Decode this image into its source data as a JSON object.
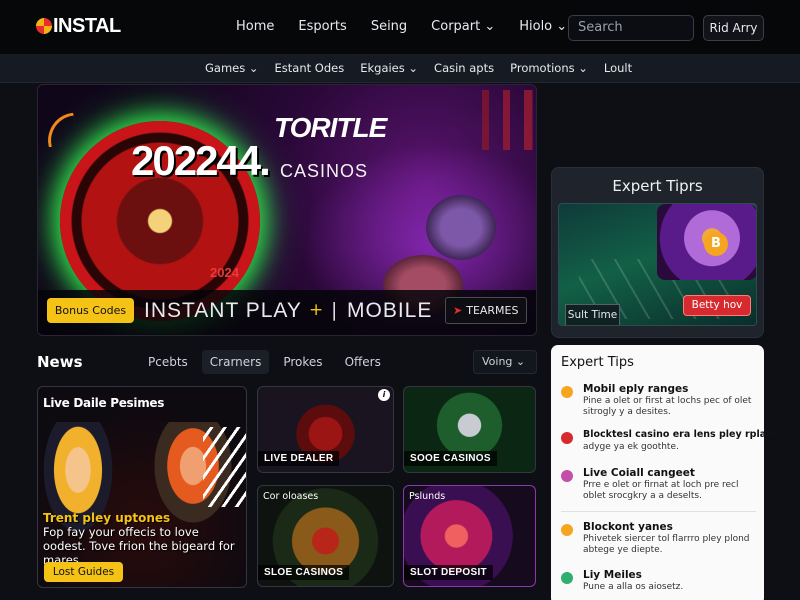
{
  "header": {
    "logo": "INSTAL",
    "nav": [
      "Home",
      "Esports",
      "Seing",
      "Corpart ⌄",
      "Hiolo ⌄"
    ],
    "search_placeholder": "Search",
    "signin_label": "Rid Arry"
  },
  "subnav": [
    "Games ⌄",
    "Estant Odes",
    "Ekgaies ⌄",
    "Casin apts",
    "Promotions ⌄",
    "Loult"
  ],
  "hero": {
    "title": "TORITLE",
    "year": "202244.",
    "casinos": "CASINOS",
    "badge": "2024",
    "bonus_button": "Bonus Codes",
    "instant": "INSTANT PLAY",
    "plus": "+",
    "pipe": "|",
    "mobile": "MOBILE",
    "teams_button": "TEARMES",
    "teams_arrow": "➤"
  },
  "expert_card": {
    "title": "Expert Tiprs",
    "coin": "B",
    "salt_button": "Sult Time",
    "betty_button": "Betty hov"
  },
  "news": {
    "title": "News",
    "filters": [
      "Pcebts",
      "Crarners",
      "Prokes",
      "Offers"
    ],
    "active_filter": 1,
    "sort": "Voing ⌄"
  },
  "cards": {
    "big": {
      "title": "Live Daile Pesimes",
      "promo_yellow": "Trent pley uptones",
      "promo_white": "Fop fay your offecis to love oodest. Tove frion the bigeard for mares.",
      "button": "Lost Guides"
    },
    "c1": {
      "label": "LIVE DEALER",
      "info": "i"
    },
    "c2": {
      "label": "SOOE CASINOS"
    },
    "c3": {
      "top": "Cor oloases",
      "label": "SLOE CASINOS"
    },
    "c4": {
      "top": "Pslunds",
      "label": "SLOT DEPOSIT"
    }
  },
  "tips": {
    "title": "Expert Tips",
    "items": [
      {
        "heading": "Mobil eply ranges",
        "body": "Pine a olet or first at lochs pec of olet sitrogly y a desites.",
        "color": "#f5a51f"
      },
      {
        "heading": "Blocktesl casino era lens pley rplard",
        "body": "adyge ya ek goothte.",
        "color": "#d62a2e"
      },
      {
        "heading": "Live Coiall cangeet",
        "body": "Prre e olet or firnat at loch pre recl oblet srocgkry a a deselts.",
        "color": "#c44fa8"
      },
      {
        "heading": "Blockont yanes",
        "body": "Phivetek siercer tol flarrro pley plond abtege ye diepte.",
        "color": "#f5a51f"
      },
      {
        "heading": "Liy Meiles",
        "body": "Pune a alla os aiosetz.",
        "color": "#2fae6f"
      }
    ]
  },
  "colors": {
    "accent": "#f5c216",
    "danger": "#d62a2e",
    "neon_green": "#2fd44a"
  }
}
